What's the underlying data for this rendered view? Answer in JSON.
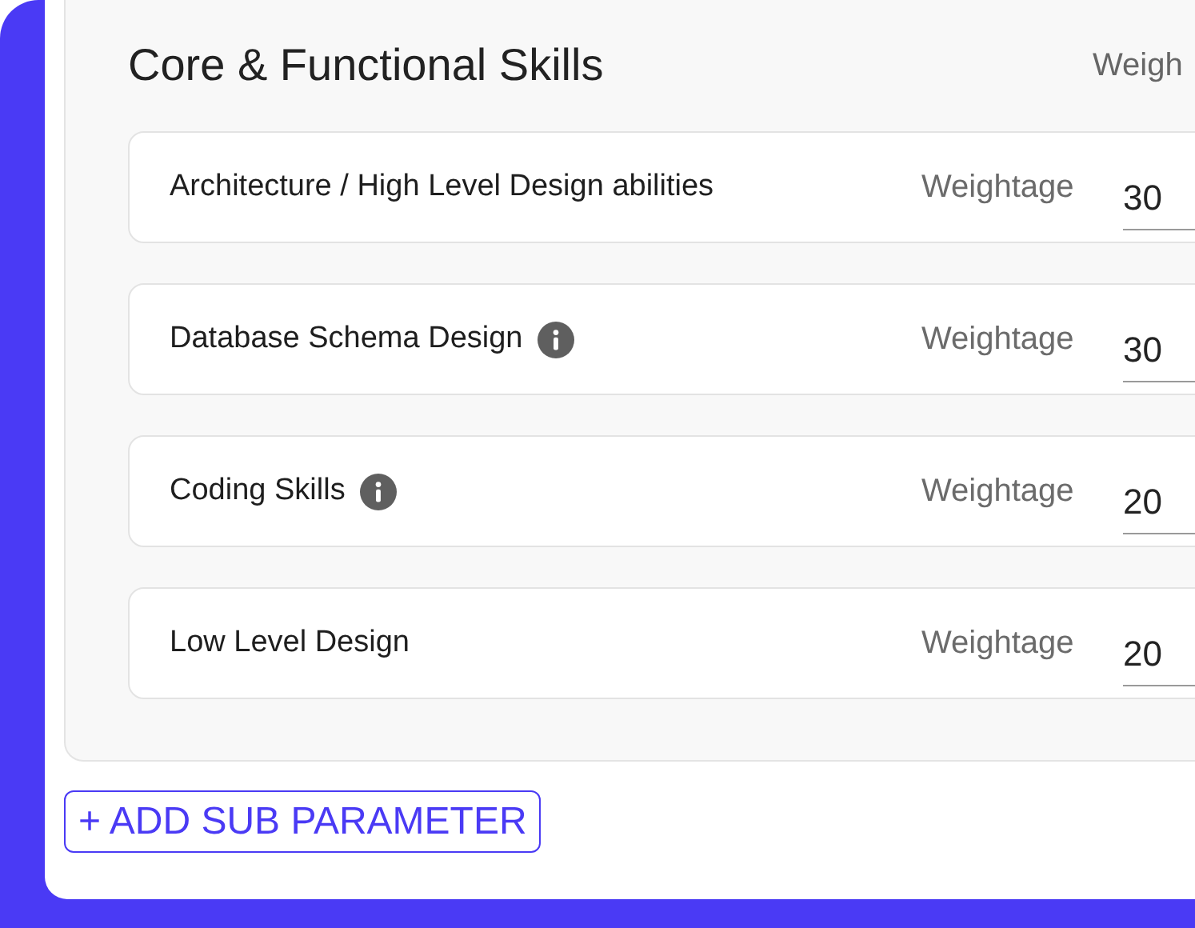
{
  "section": {
    "title": "Core & Functional Skills",
    "column_header": "Weigh"
  },
  "rows": [
    {
      "label": "Architecture / High Level Design abilities",
      "info": false,
      "weight_label": "Weightage",
      "value": "30"
    },
    {
      "label": "Database Schema Design",
      "info": true,
      "weight_label": "Weightage",
      "value": "30"
    },
    {
      "label": "Coding Skills",
      "info": true,
      "weight_label": "Weightage",
      "value": "20"
    },
    {
      "label": "Low Level Design",
      "info": false,
      "weight_label": "Weightage",
      "value": "20"
    }
  ],
  "add_button": "+ ADD SUB PARAMETER"
}
